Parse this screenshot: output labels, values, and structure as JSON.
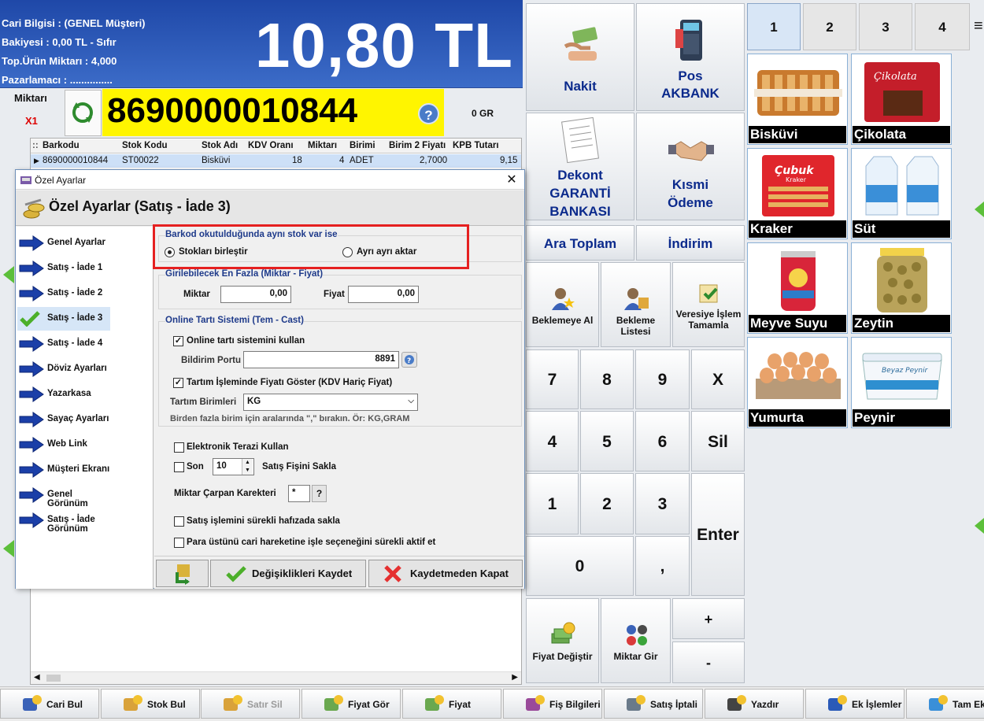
{
  "customer": {
    "line1": "Cari Bilgisi : (GENEL Müşteri)",
    "line2": "Bakiyesi : 0,00 TL - Sıfır",
    "line3": "Top.Ürün Miktarı : 4,000",
    "line4": "Pazarlamacı : ...............",
    "total": "10,80 TL"
  },
  "entry": {
    "qty_label": "Miktarı",
    "qty_mult": "X1",
    "barcode": "8690000010844",
    "help": "?",
    "weight": "0 GR"
  },
  "grid": {
    "headers": [
      "Barkodu",
      "Stok Kodu",
      "Stok Adı",
      "KDV Oranı",
      "Miktarı",
      "Birimi",
      "Birim 2 Fiyatı",
      "KPB Tutarı"
    ],
    "row": [
      "8690000010844",
      "ST00022",
      "Bisküvi",
      "18",
      "4",
      "ADET",
      "2,7000",
      "9,15"
    ]
  },
  "dialog": {
    "window_title": "Özel Ayarlar",
    "close": "✕",
    "header": "Özel Ayarlar (Satış - İade 3)",
    "menu": [
      "Genel Ayarlar",
      "Satış - İade 1",
      "Satış - İade 2",
      "Satış - İade 3",
      "Satış - İade 4",
      "Döviz Ayarları",
      "Yazarkasa",
      "Sayaç Ayarları",
      "Web Link",
      "Müşteri Ekranı",
      "Genel Görünüm",
      "Satış - İade Görünüm"
    ],
    "barcode_group": {
      "title": "Barkod okutulduğunda aynı stok var ise",
      "opt1": "Stokları birleştir",
      "opt2": "Ayrı ayrı aktar"
    },
    "max_group": {
      "title": "Girilebilecek En Fazla (Miktar - Fiyat)",
      "qty_label": "Miktar",
      "qty_value": "0,00",
      "price_label": "Fiyat",
      "price_value": "0,00"
    },
    "scale_group": {
      "title": "Online Tartı Sistemi (Tem - Cast)",
      "use_label": "Online tartı sistemini kullan",
      "port_label": "Bildirim Portu",
      "port_value": "8891",
      "show_price_label": "Tartım İşleminde Fiyatı Göster (KDV Hariç Fiyat)",
      "units_label": "Tartım Birimleri",
      "units_value": "KG",
      "hint": "Birden fazla birim için aralarında \",\" bırakın. Ör: KG,GRAM"
    },
    "electronic_scale": "Elektronik Terazi Kullan",
    "last_label": "Son",
    "last_value": "10",
    "keep_receipt": "Satış Fişini Sakla",
    "mult_label": "Miktar Çarpan Karekteri",
    "mult_value": "*",
    "mult_help": "?",
    "keep_memory": "Satış işlemini sürekli hafızada sakla",
    "change_option": "Para üstünü cari hareketine işle seçeneğini sürekli aktif et",
    "save": "Değişiklikleri Kaydet",
    "close_nosave": "Kaydetmeden Kapat"
  },
  "pay": {
    "cash": "Nakit",
    "pos1": "Pos",
    "pos2": "AKBANK",
    "dekont1": "Dekont",
    "dekont2": "GARANTİ",
    "dekont3": "BANKASI",
    "partial1": "Kısmi",
    "partial2": "Ödeme",
    "subtotal": "Ara Toplam",
    "discount": "İndirim",
    "hold1": "Beklemeye Al",
    "hold_list1": "Bekleme",
    "hold_list2": "Listesi",
    "credit1": "Veresiye İşlem",
    "credit2": "Tamamla"
  },
  "keypad": {
    "k7": "7",
    "k8": "8",
    "k9": "9",
    "kx": "X",
    "k4": "4",
    "k5": "5",
    "k6": "6",
    "sil": "Sil",
    "k1": "1",
    "k2": "2",
    "k3": "3",
    "enter": "Enter",
    "k0": "0",
    "comma": ",",
    "plus": "+",
    "minus": "-",
    "price_change": "Fiyat Değiştir",
    "qty_enter": "Miktar Gir"
  },
  "pages": [
    "1",
    "2",
    "3",
    "4"
  ],
  "products": [
    "Bisküvi",
    "Çikolata",
    "Kraker",
    "Süt",
    "Meyve Suyu",
    "Zeytin",
    "Yumurta",
    "Peynir"
  ],
  "product_images": {
    "choc_brand": "Çikolata",
    "cracker_brand": "Çubuk",
    "cracker_sub": "Kraker",
    "cheese_brand": "Beyaz Peynir"
  },
  "bottom": [
    "Cari Bul",
    "Stok Bul",
    "Satır Sil",
    "Fiyat Gör",
    "Fiyat",
    "Fiş Bilgileri",
    "Satış İptali",
    "Yazdır",
    "Ek İşlemler",
    "Tam Ekran"
  ],
  "colors": {
    "accent": "#0b2a8c",
    "barcode_bg": "#fff500",
    "highlight": "#e52020"
  }
}
